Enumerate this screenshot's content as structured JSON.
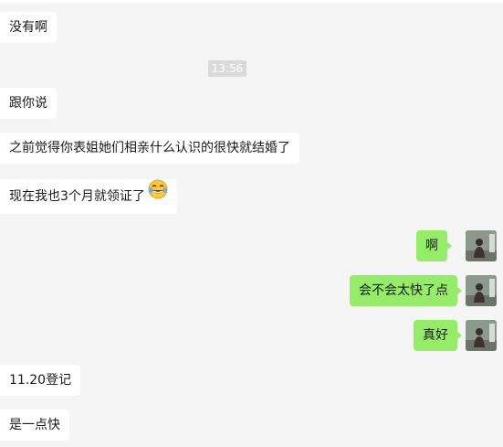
{
  "timestamp": "13:56",
  "messages": [
    {
      "side": "incoming",
      "text": "没有啊"
    },
    {
      "side": "incoming",
      "text": "跟你说"
    },
    {
      "side": "incoming",
      "text": "之前觉得你表姐她们相亲什么认识的很快就结婚了"
    },
    {
      "side": "incoming",
      "text": "现在我也3个月就领证了",
      "emoji": "laughing-crying-emoji"
    },
    {
      "side": "outgoing",
      "text": "啊"
    },
    {
      "side": "outgoing",
      "text": "会不会太快了点"
    },
    {
      "side": "outgoing",
      "text": "真好"
    },
    {
      "side": "incoming",
      "text": "11.20登记"
    },
    {
      "side": "incoming",
      "text": "是一点快"
    }
  ],
  "colors": {
    "background": "#f5f5f5",
    "incoming_bubble": "#ffffff",
    "outgoing_bubble": "#95ec69",
    "timestamp_bg": "#dadada"
  }
}
